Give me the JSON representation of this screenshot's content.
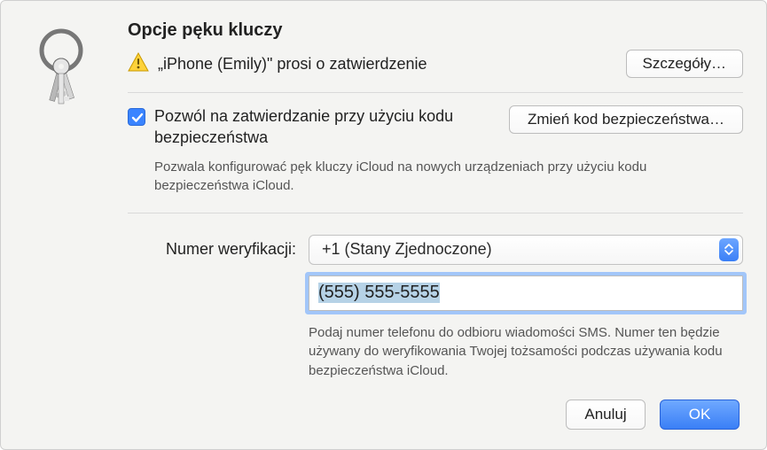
{
  "title": "Opcje pęku kluczy",
  "approval": {
    "text": "„iPhone (Emily)\" prosi o zatwierdzenie",
    "details_button": "Szczegóły…"
  },
  "allow": {
    "checked": true,
    "label": "Pozwól na zatwierdzanie przy użyciu kodu bezpieczeństwa",
    "change_button": "Zmień kod bezpieczeństwa…",
    "help": "Pozwala konfigurować pęk kluczy iCloud na nowych urządzeniach przy użyciu kodu bezpieczeństwa iCloud."
  },
  "verification": {
    "label": "Numer weryfikacji:",
    "country_selected": "+1 (Stany Zjednoczone)",
    "phone_value": "(555) 555-5555",
    "help": "Podaj numer telefonu do odbioru wiadomości SMS. Numer ten będzie używany do weryfikowania Twojej tożsamości podczas używania kodu bezpieczeństwa iCloud."
  },
  "buttons": {
    "cancel": "Anuluj",
    "ok": "OK"
  }
}
